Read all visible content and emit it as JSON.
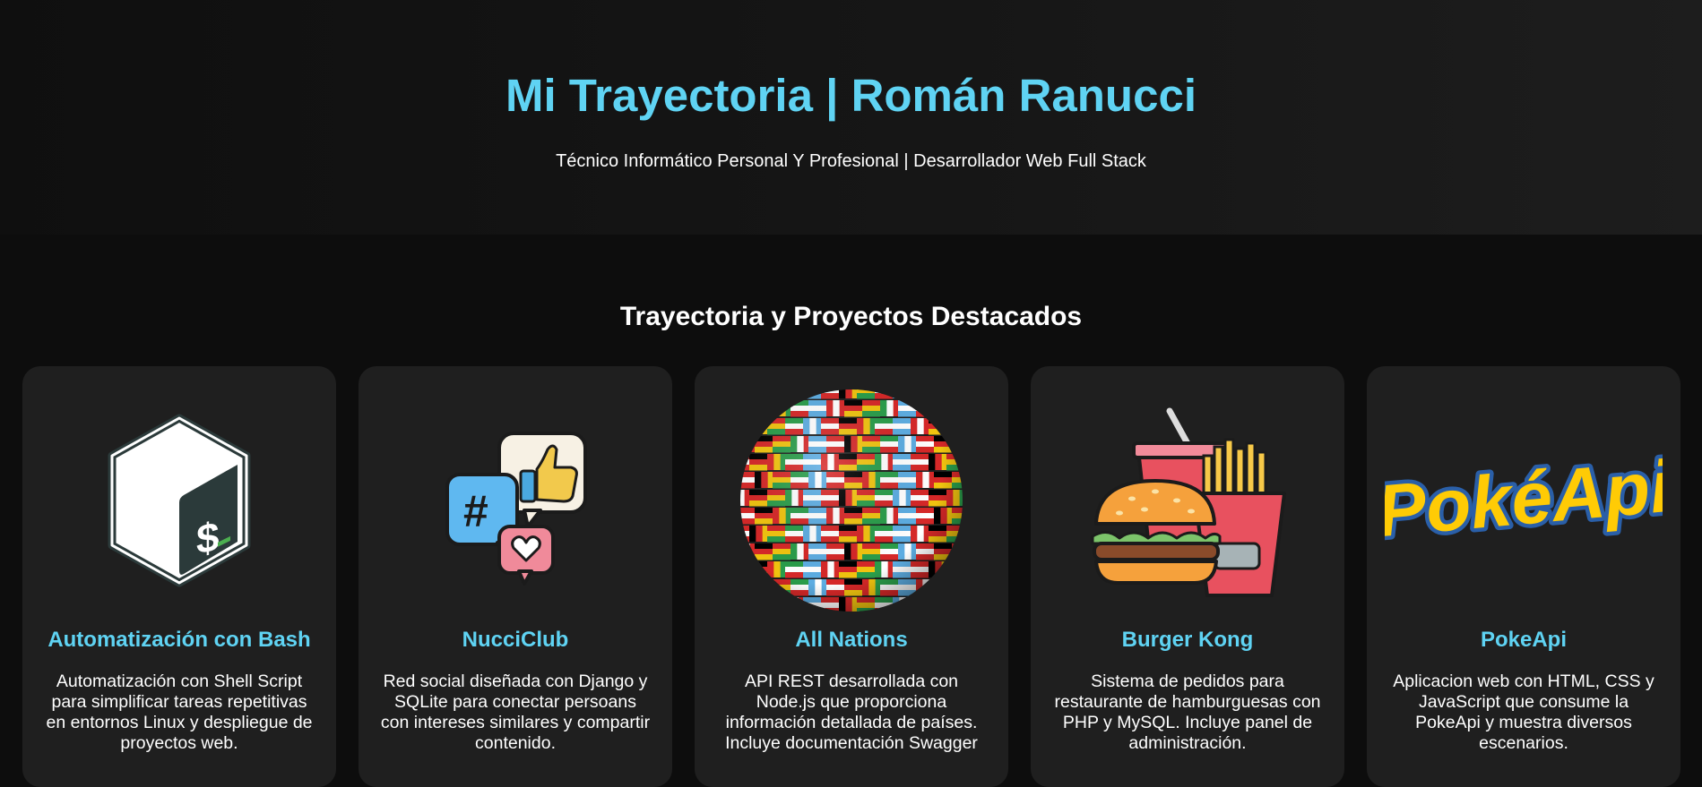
{
  "hero": {
    "title": "Mi Trayectoria | Román Ranucci",
    "subtitle": "Técnico Informático Personal Y Profesional | Desarrollador Web Full Stack"
  },
  "projects_section": {
    "title": "Trayectoria y Proyectos Destacados"
  },
  "projects": [
    {
      "title": "Automatización con Bash",
      "description": "Automatización con Shell Script para simplificar tareas repetitivas en entornos Linux y despliegue de proyectos web.",
      "icon": "bash-logo-icon"
    },
    {
      "title": "NucciClub",
      "description": "Red social diseñada con Django y SQLite para conectar persoans con intereses similares y compartir contenido.",
      "icon": "social-media-icon"
    },
    {
      "title": "All Nations",
      "description": "API REST desarrollada con Node.js que proporciona información detallada de países. Incluye documentación Swagger",
      "icon": "flags-globe-icon"
    },
    {
      "title": "Burger Kong",
      "description": "Sistema de pedidos para restaurante de hamburguesas con PHP y MySQL. Incluye panel de administración.",
      "icon": "burger-fries-icon"
    },
    {
      "title": "PokeApi",
      "description": "Aplicacion web con HTML, CSS y JavaScript que consume la PokeApi y muestra diversos escenarios.",
      "icon": "pokeapi-logo-icon",
      "logo_text": "PokéApi"
    }
  ],
  "colors": {
    "accent": "#5fd3f3",
    "card_bg": "#1f1f1f",
    "page_bg": "#0d0d0d"
  }
}
